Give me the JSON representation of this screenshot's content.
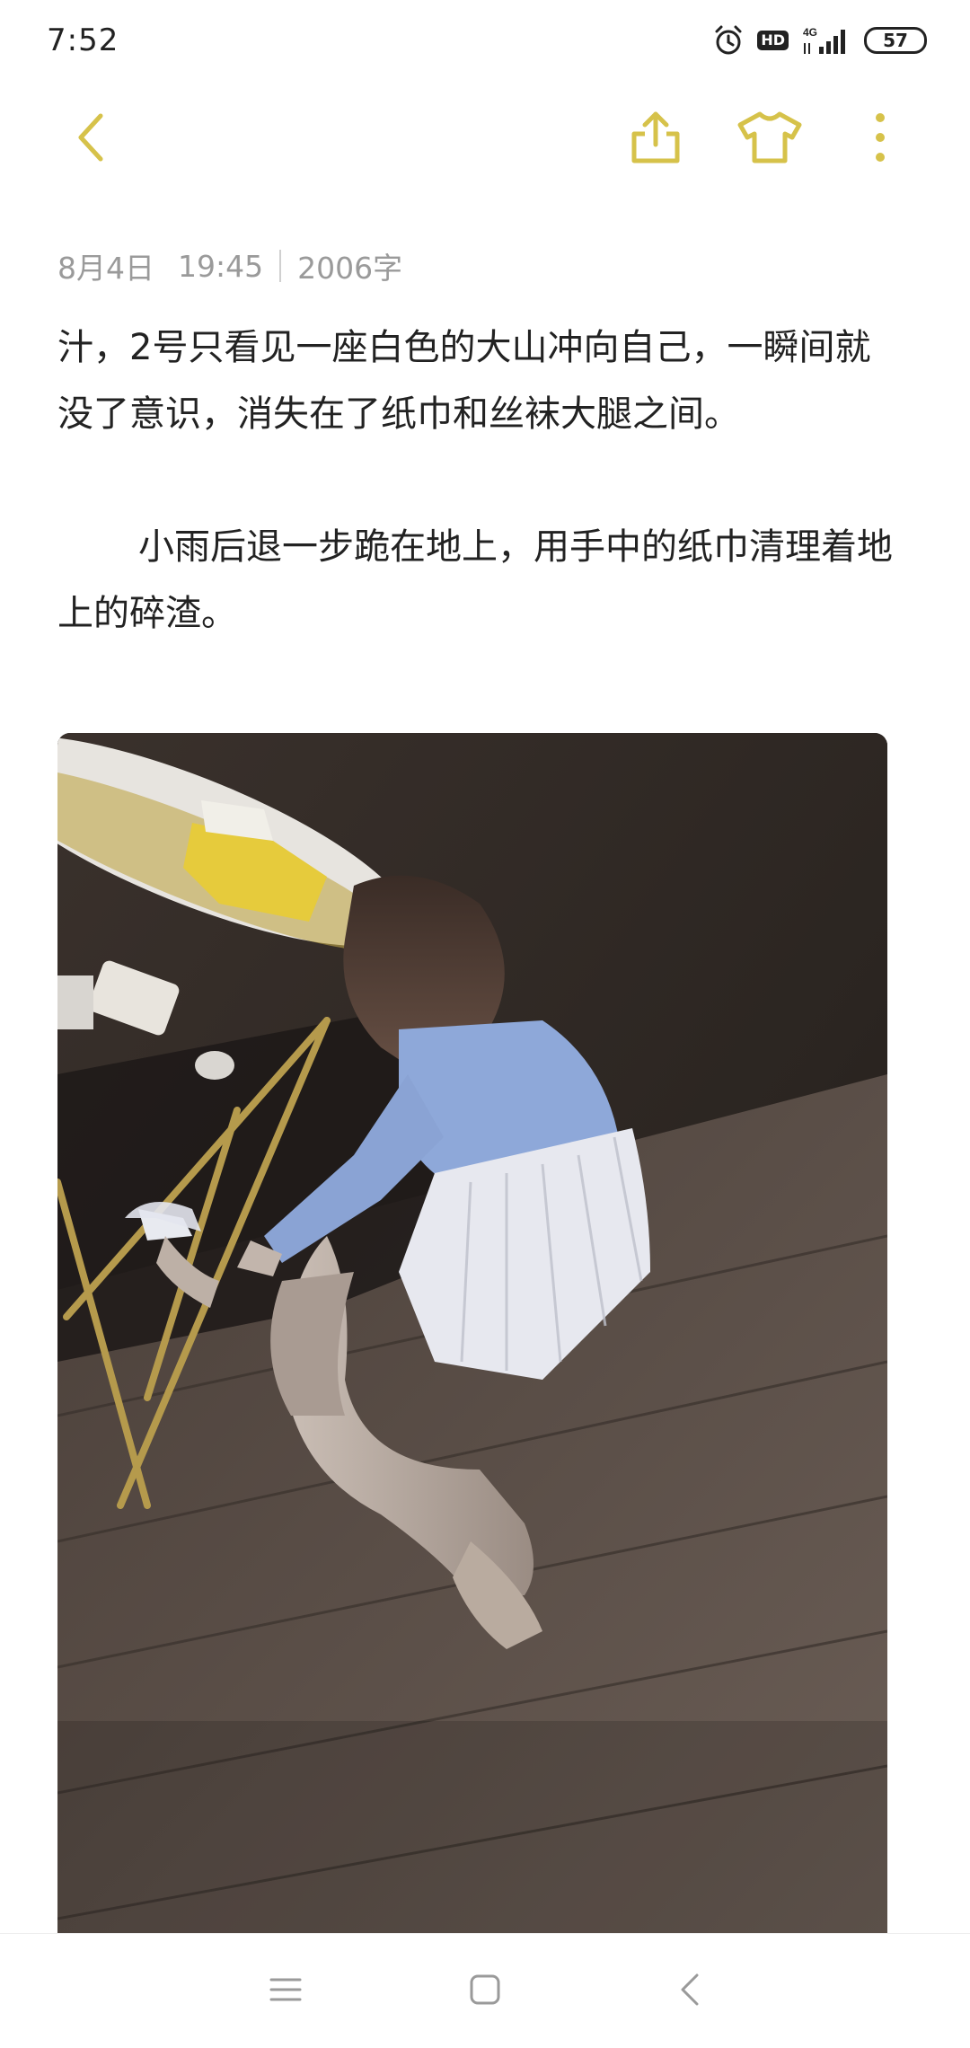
{
  "status_bar": {
    "time": "7:52",
    "network": "4G",
    "hd_label": "HD",
    "battery": "57"
  },
  "toolbar": {
    "accent_color": "#d6c24a",
    "back_icon": "chevron-left-icon",
    "share_icon": "share-icon",
    "theme_icon": "tshirt-icon",
    "more_icon": "more-vertical-icon"
  },
  "note": {
    "date": "8月4日",
    "time": "19:45",
    "word_count": "2006字",
    "paragraphs": [
      "汁，2号只看见一座白色的大山冲向自己，一瞬间就没了意识，消失在了纸巾和丝袜大腿之间。",
      "小雨后退一步跪在地上，用手中的纸巾清理着地上的碎渣。"
    ],
    "image_icon": "photo-image"
  },
  "nav_bar": {
    "menu_icon": "menu-icon",
    "home_icon": "home-square-icon",
    "back_icon": "back-chevron-icon"
  }
}
